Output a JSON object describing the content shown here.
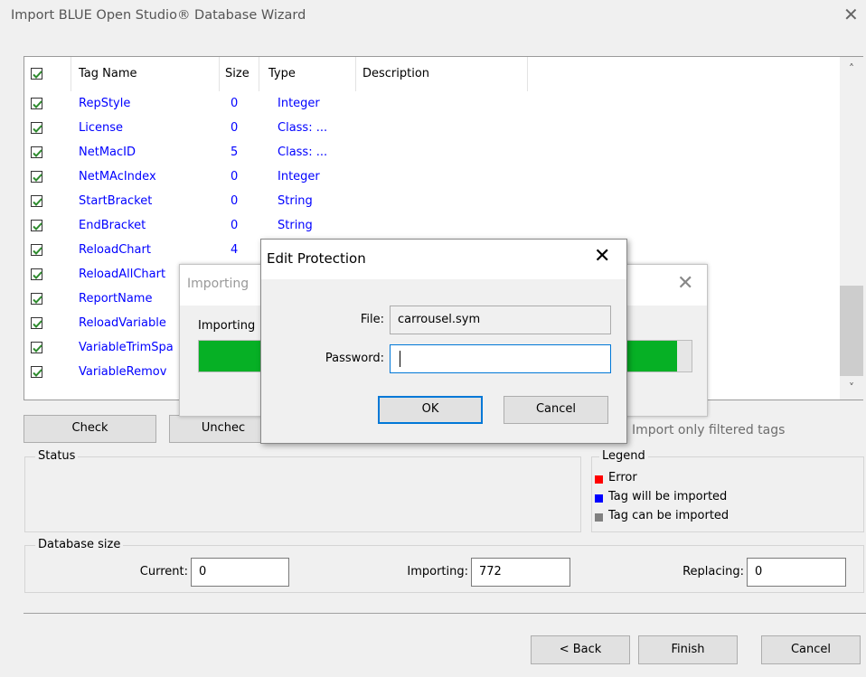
{
  "wizard": {
    "title": "Import BLUE Open Studio® Database Wizard",
    "close_glyph": "✕"
  },
  "table": {
    "headers": {
      "tag_name": "Tag Name",
      "size": "Size",
      "type": "Type",
      "description": "Description"
    },
    "rows": [
      {
        "name": "RepStyle",
        "size": "0",
        "type": "Integer",
        "checked": true
      },
      {
        "name": "License",
        "size": "0",
        "type": "Class: ...",
        "checked": true
      },
      {
        "name": "NetMacID",
        "size": "5",
        "type": "Class: ...",
        "checked": true
      },
      {
        "name": "NetMAcIndex",
        "size": "0",
        "type": "Integer",
        "checked": true
      },
      {
        "name": "StartBracket",
        "size": "0",
        "type": "String",
        "checked": true
      },
      {
        "name": "EndBracket",
        "size": "0",
        "type": "String",
        "checked": true
      },
      {
        "name": "ReloadChart",
        "size": "4",
        "type": "",
        "checked": true
      },
      {
        "name": "ReloadAllChart",
        "size": "",
        "type": "",
        "checked": true
      },
      {
        "name": "ReportName",
        "size": "",
        "type": "",
        "checked": true
      },
      {
        "name": "ReloadVariable",
        "size": "",
        "type": "",
        "checked": true
      },
      {
        "name": "VariableTrimSpa",
        "size": "",
        "type": "",
        "checked": true
      },
      {
        "name": "VariableRemov",
        "size": "",
        "type": "",
        "checked": true
      }
    ],
    "scroll_up": "˄",
    "scroll_down": "˅"
  },
  "buttons": {
    "check": "Check",
    "uncheck": "Unchec",
    "import_only_filtered": "Import only filtered tags",
    "back": "< Back",
    "finish": "Finish",
    "cancel": "Cancel"
  },
  "status": {
    "label": "Status"
  },
  "legend": {
    "label": "Legend",
    "items": [
      {
        "text": "Error",
        "color": "#ff0000"
      },
      {
        "text": "Tag will be imported",
        "color": "#0000ff"
      },
      {
        "text": "Tag can be imported",
        "color": "#808080"
      }
    ]
  },
  "database_size": {
    "label": "Database size",
    "current_label": "Current:",
    "current_value": "0",
    "importing_label": "Importing:",
    "importing_value": "772",
    "replacing_label": "Replacing:",
    "replacing_value": "0"
  },
  "importing_dialog": {
    "title": "Importing",
    "text": "Importing",
    "close_glyph": "✕",
    "progress_percent": 97
  },
  "edit_protection": {
    "title": "Edit Protection",
    "close_glyph": "✕",
    "file_label": "File:",
    "file_value": "carrousel.sym",
    "password_label": "Password:",
    "password_value": "",
    "ok": "OK",
    "cancel": "Cancel"
  },
  "colors": {
    "tag_text": "#0000ff",
    "progress": "#06b025",
    "focus_border": "#0078d7"
  }
}
